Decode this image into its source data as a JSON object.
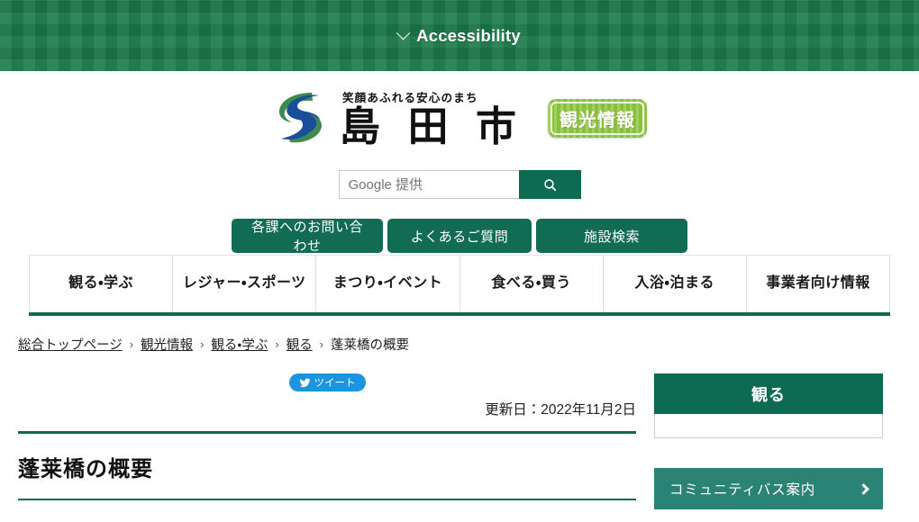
{
  "accessibility_bar": {
    "label": "Accessibility",
    "chevron_icon": "chevron-down-icon"
  },
  "header": {
    "logo": {
      "tagline": "笑顔あふれる安心のまち",
      "city_name": "島 田 市",
      "mark_icon": "shimada-s-logo-icon",
      "mark_colors": {
        "green": "#3f8a4f",
        "blue": "#1a4e9b"
      }
    },
    "tourism_badge": {
      "label": "観光情報",
      "color": "#8cc63f"
    },
    "search": {
      "placeholder": "Google 提供",
      "value": "",
      "button_icon": "search-icon",
      "button_color": "#0d6b52"
    },
    "quick_buttons": [
      {
        "label": "各課へのお問い合わせ"
      },
      {
        "label": "よくあるご質問"
      },
      {
        "label": "施設検索"
      }
    ]
  },
  "nav": {
    "items": [
      {
        "label": "観る・学ぶ"
      },
      {
        "label": "レジャー・スポーツ"
      },
      {
        "label": "まつり・イベント"
      },
      {
        "label": "食べる・買う"
      },
      {
        "label": "入浴・泊まる"
      },
      {
        "label": "事業者向け情報"
      }
    ]
  },
  "breadcrumb": {
    "items": [
      {
        "label": "総合トップページ",
        "link": true
      },
      {
        "label": "観光情報",
        "link": true
      },
      {
        "label": "観る・学ぶ",
        "link": true
      },
      {
        "label": "観る",
        "link": true
      },
      {
        "label": "蓬莱橋の概要",
        "link": false
      }
    ],
    "separator": "›"
  },
  "main": {
    "tweet_button": {
      "label": "ツイート",
      "icon": "twitter-bird-icon",
      "color": "#1b95e0"
    },
    "update_date": "更新日：2022年11月2日",
    "page_title": "蓬莱橋の概要"
  },
  "sidebar": {
    "section_title": "観る",
    "bus_banner": {
      "label": "コミュニティバス案内",
      "icon": "chevron-right-icon",
      "color": "#2a8374"
    }
  },
  "theme": {
    "primary_green": "#0d6b52",
    "accent_green": "#2a8374",
    "banner_green": "#1b7a4b"
  }
}
